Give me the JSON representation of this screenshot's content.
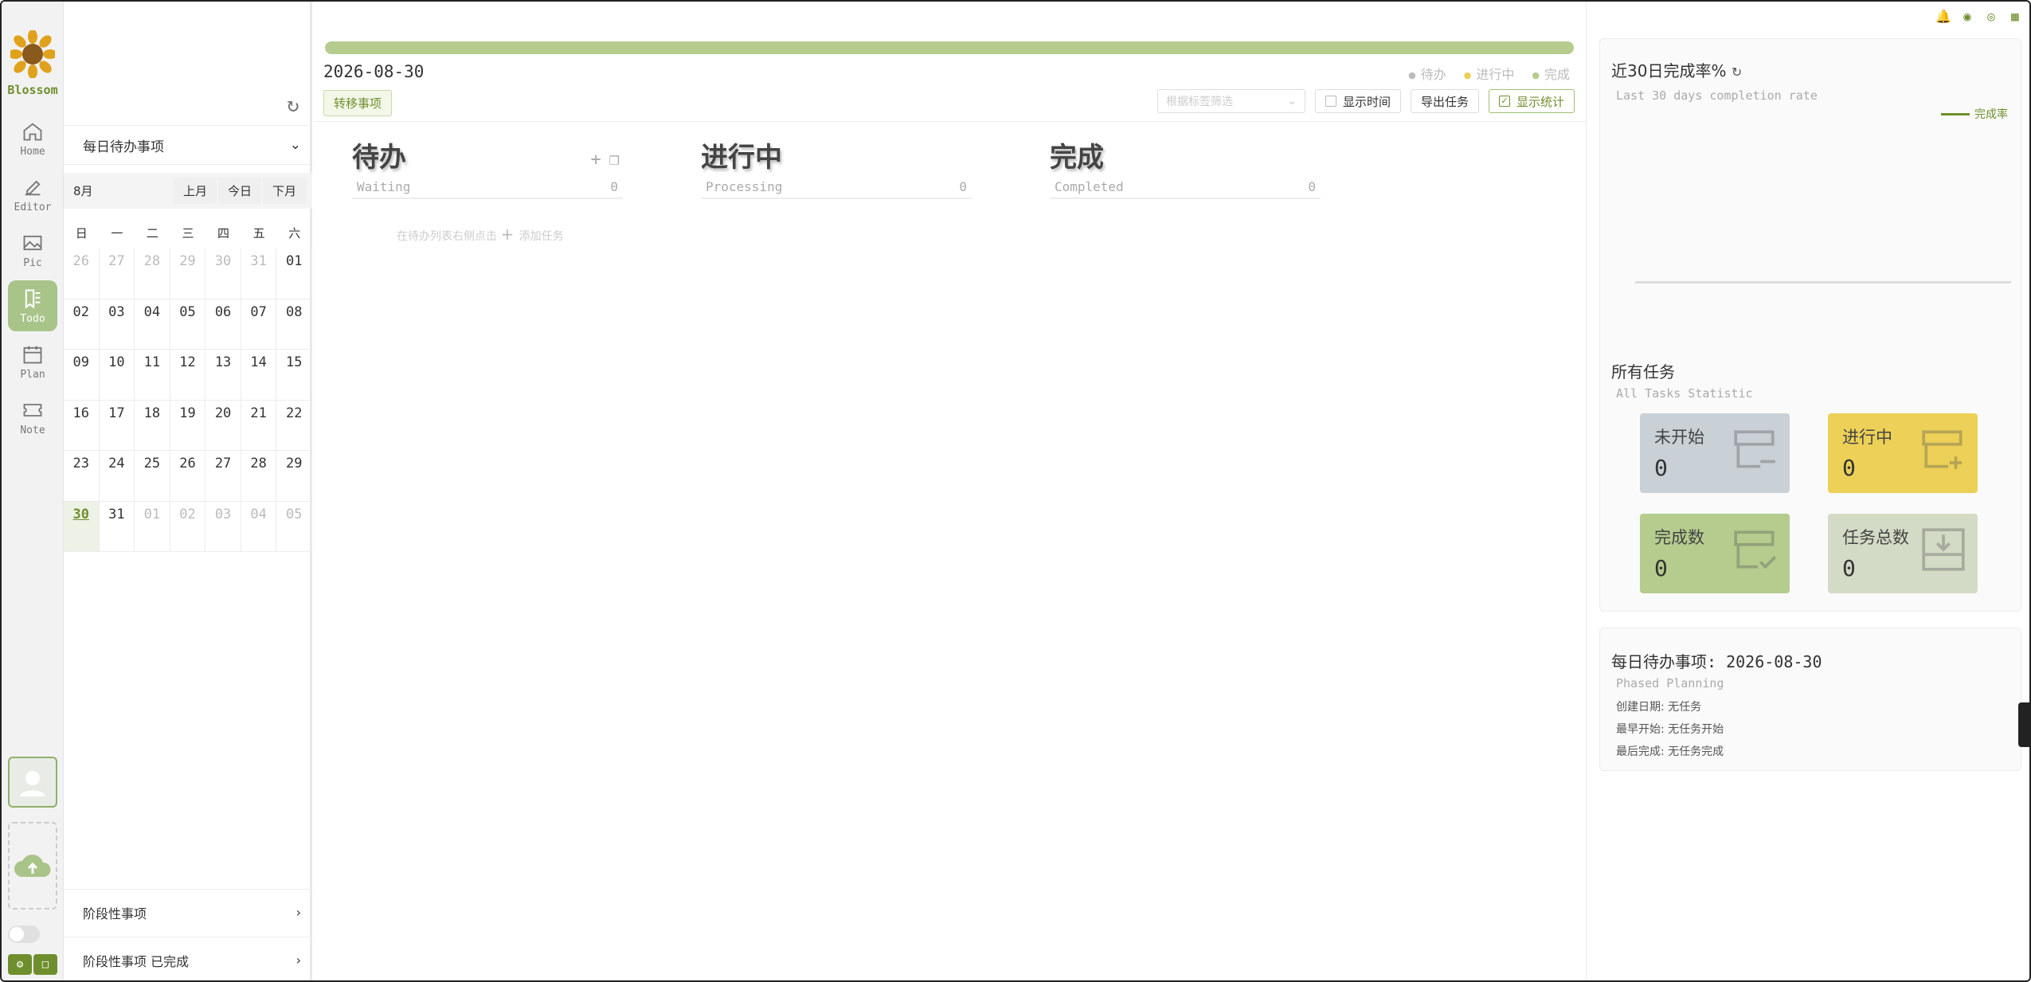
{
  "app": {
    "name": "Blossom"
  },
  "nav": [
    {
      "label": "Home",
      "icon": "home-icon"
    },
    {
      "label": "Editor",
      "icon": "editor-icon"
    },
    {
      "label": "Pic",
      "icon": "picture-icon"
    },
    {
      "label": "Todo",
      "icon": "todo-icon",
      "active": true
    },
    {
      "label": "Plan",
      "icon": "calendar-icon"
    },
    {
      "label": "Note",
      "icon": "note-icon"
    }
  ],
  "calendar": {
    "header": "每日待办事项",
    "month": "8月",
    "prev": "上月",
    "today": "今日",
    "next": "下月",
    "weekdays": [
      "日",
      "一",
      "二",
      "三",
      "四",
      "五",
      "六"
    ],
    "days": [
      {
        "d": "26",
        "dim": true
      },
      {
        "d": "27",
        "dim": true
      },
      {
        "d": "28",
        "dim": true
      },
      {
        "d": "29",
        "dim": true
      },
      {
        "d": "30",
        "dim": true
      },
      {
        "d": "31",
        "dim": true
      },
      {
        "d": "01"
      },
      {
        "d": "02"
      },
      {
        "d": "03"
      },
      {
        "d": "04"
      },
      {
        "d": "05"
      },
      {
        "d": "06"
      },
      {
        "d": "07"
      },
      {
        "d": "08"
      },
      {
        "d": "09"
      },
      {
        "d": "10"
      },
      {
        "d": "11"
      },
      {
        "d": "12"
      },
      {
        "d": "13"
      },
      {
        "d": "14"
      },
      {
        "d": "15"
      },
      {
        "d": "16"
      },
      {
        "d": "17"
      },
      {
        "d": "18"
      },
      {
        "d": "19"
      },
      {
        "d": "20"
      },
      {
        "d": "21"
      },
      {
        "d": "22"
      },
      {
        "d": "23"
      },
      {
        "d": "24"
      },
      {
        "d": "25"
      },
      {
        "d": "26"
      },
      {
        "d": "27"
      },
      {
        "d": "28"
      },
      {
        "d": "29"
      },
      {
        "d": "30",
        "today": true
      },
      {
        "d": "31"
      },
      {
        "d": "01",
        "dim": true
      },
      {
        "d": "02",
        "dim": true
      },
      {
        "d": "03",
        "dim": true
      },
      {
        "d": "04",
        "dim": true
      },
      {
        "d": "05",
        "dim": true
      }
    ],
    "stage": "阶段性事项",
    "stage_done": "阶段性事项  已完成"
  },
  "main": {
    "date": "2026-08-30",
    "legend": {
      "waiting": "待办",
      "processing": "进行中",
      "done": "完成"
    },
    "move_btn": "转移事项",
    "tag_filter_placeholder": "根据标签筛选",
    "show_time": "显示时间",
    "export": "导出任务",
    "show_stats": "显示统计",
    "columns": [
      {
        "title": "待办",
        "sub": "Waiting",
        "count": "0"
      },
      {
        "title": "进行中",
        "sub": "Processing",
        "count": "0"
      },
      {
        "title": "完成",
        "sub": "Completed",
        "count": "0"
      }
    ],
    "hint_before": "在待办列表右侧点击",
    "hint_after": "添加任务"
  },
  "stats": {
    "rate_title": "近30日完成率%",
    "rate_sub": "Last 30 days completion rate",
    "rate_legend": "完成率",
    "all_title": "所有任务",
    "all_sub": "All Tasks Statistic",
    "cards": [
      {
        "label": "未开始",
        "value": "0",
        "color": "#c9d0d6"
      },
      {
        "label": "进行中",
        "value": "0",
        "color": "#ecd057"
      },
      {
        "label": "完成数",
        "value": "0",
        "color": "#b5cc8e"
      },
      {
        "label": "任务总数",
        "value": "0",
        "color": "#d3dbc6"
      }
    ]
  },
  "daily": {
    "title": "每日待办事项: 2026-08-30",
    "sub": "Phased Planning",
    "created": "创建日期: 无任务",
    "earliest_start": "最早开始: 无任务开始",
    "last_done": "最后完成: 无任务完成"
  },
  "colors": {
    "accent": "#6f8f2e",
    "progress": "#b5cc8e",
    "yellow": "#ecd057"
  }
}
